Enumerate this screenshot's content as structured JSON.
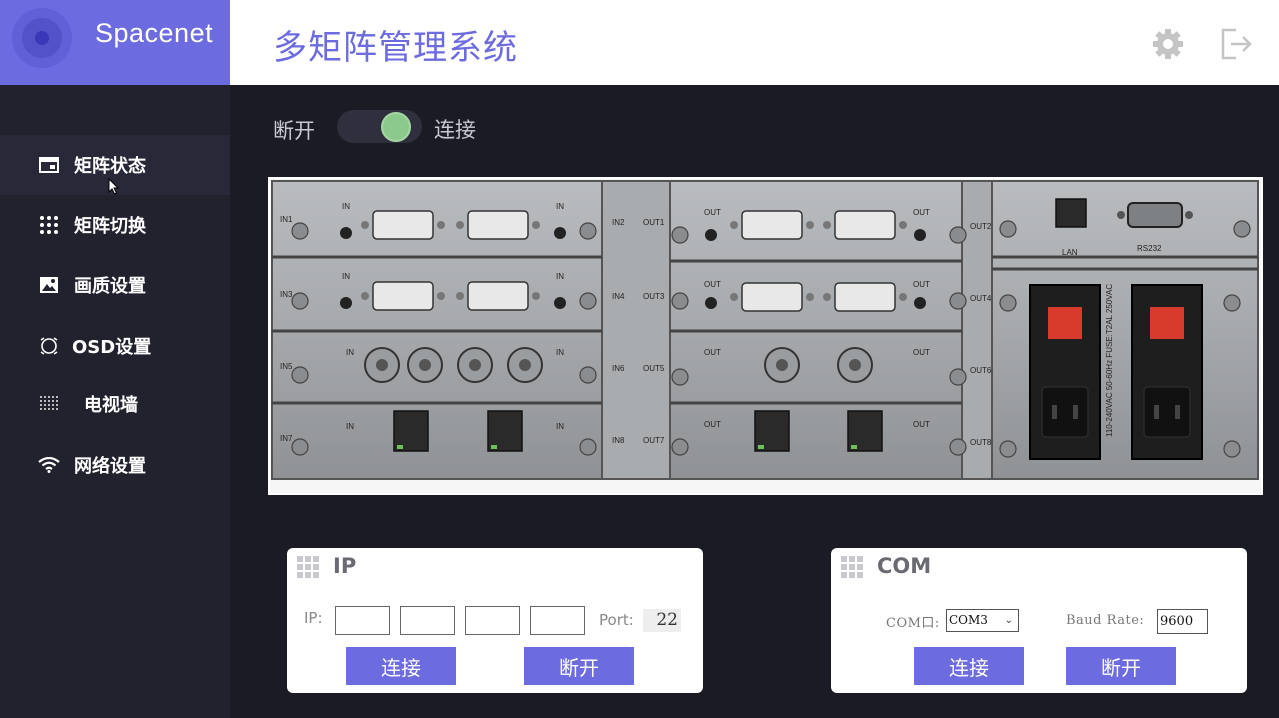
{
  "brand": {
    "name": "Spacenet"
  },
  "header": {
    "title": "多矩阵管理系统"
  },
  "sidebar": {
    "items": [
      {
        "label": "矩阵状态",
        "icon": "window-icon",
        "active": true
      },
      {
        "label": "矩阵切换",
        "icon": "dots-grid-icon",
        "active": false
      },
      {
        "label": "画质设置",
        "icon": "image-icon",
        "active": false
      },
      {
        "label": "OSD设置",
        "icon": "osd-icon",
        "active": false
      },
      {
        "label": "电视墙",
        "icon": "tv-wall-icon",
        "active": false
      },
      {
        "label": "网络设置",
        "icon": "wifi-icon",
        "active": false
      }
    ]
  },
  "connection": {
    "off_label": "断开",
    "on_label": "连接",
    "state": "on"
  },
  "device": {
    "labels": {
      "in1": "IN1",
      "in2": "IN2",
      "in3": "IN3",
      "in4": "IN4",
      "in5": "IN5",
      "in6": "IN6",
      "in7": "IN7",
      "in8": "IN8",
      "out1": "OUT1",
      "out2": "OUT2",
      "out3": "OUT3",
      "out4": "OUT4",
      "out5": "OUT5",
      "out6": "OUT6",
      "out7": "OUT7",
      "out8": "OUT8",
      "in": "IN",
      "out": "OUT",
      "lan": "LAN",
      "rs232": "RS232",
      "power_spec": "110-240VAC 50-60Hz FUSE:T2AL 250VAC"
    }
  },
  "ip_panel": {
    "title": "IP",
    "ip_label": "IP:",
    "ip_octets": [
      "",
      "",
      "",
      ""
    ],
    "port_label": "Port:",
    "port_value": "22",
    "connect_label": "连接",
    "disconnect_label": "断开"
  },
  "com_panel": {
    "title": "COM",
    "com_label": "COM口:",
    "com_value": "COM3",
    "baud_label": "Baud Rate:",
    "baud_value": "9600",
    "connect_label": "连接",
    "disconnect_label": "断开"
  },
  "colors": {
    "accent": "#6c6bdf",
    "sidebar": "#22222f",
    "background": "#1b1b26",
    "toggle_on": "#8cc98c"
  }
}
